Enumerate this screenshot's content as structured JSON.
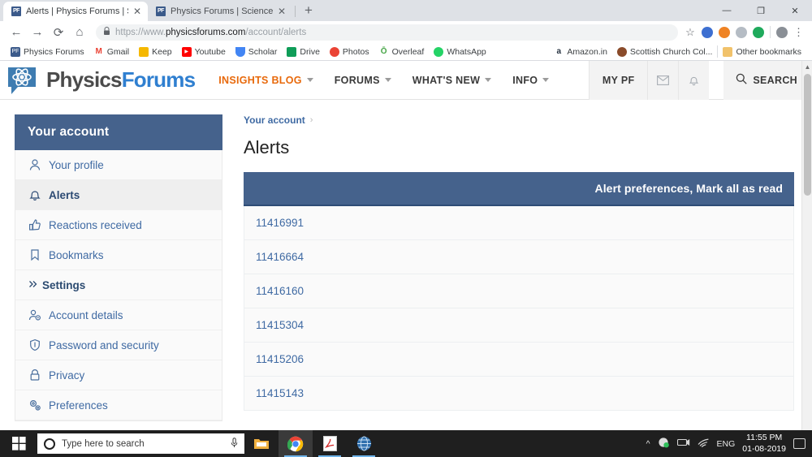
{
  "browser": {
    "tabs": [
      {
        "favicon": "PF",
        "title": "Alerts | Physics Forums | Science ",
        "close": "✕",
        "active": true
      },
      {
        "favicon": "PF",
        "title": "Physics Forums | Science Articles",
        "close": "✕",
        "active": false
      }
    ],
    "new_tab_label": "+",
    "window_controls": {
      "minimize": "—",
      "maximize": "❐",
      "close": "✕"
    },
    "nav": {
      "back": "←",
      "forward": "→",
      "reload": "⟳",
      "home": "⌂"
    },
    "omnibox": {
      "lock_icon": "🔒",
      "url_prefix": "https://www.",
      "url_domain": "physicsforums.com",
      "url_path": "/account/alerts",
      "star_icon": "☆"
    },
    "extensions": [
      {
        "name": "shield-blue-icon",
        "color": "#3d6fd1"
      },
      {
        "name": "circle-orange-icon",
        "color": "#ef8324"
      },
      {
        "name": "shield-gray-icon",
        "color": "#b5bcc4"
      },
      {
        "name": "circle-green-icon",
        "color": "#1faa5c"
      }
    ],
    "profile_avatar": "avatar",
    "menu_dots": "⋮",
    "bookmarks": [
      {
        "label": "Physics Forums",
        "icon_text": "PF",
        "color": "#3b5a8a"
      },
      {
        "label": "Gmail",
        "icon_text": "M",
        "color": "#ea4335"
      },
      {
        "label": "Keep",
        "icon_text": "",
        "color": "#f5b800"
      },
      {
        "label": "Youtube",
        "icon_text": "▶",
        "color": "#ff0000"
      },
      {
        "label": "Scholar",
        "icon_text": "",
        "color": "#4285f4"
      },
      {
        "label": "Drive",
        "icon_text": "",
        "color": "#0f9d58"
      },
      {
        "label": "Photos",
        "icon_text": "",
        "color": "#ea4335"
      },
      {
        "label": "Overleaf",
        "icon_text": "Ō",
        "color": "#46a546"
      },
      {
        "label": "WhatsApp",
        "icon_text": "",
        "color": "#25d366"
      },
      {
        "label": "Amazon.in",
        "icon_text": "a",
        "color": "#ff9900"
      },
      {
        "label": "Scottish Church Col...",
        "icon_text": "",
        "color": "#8a4b2a"
      },
      {
        "label": "Other bookmarks",
        "icon_text": "",
        "color": "#f1c26b"
      }
    ]
  },
  "site": {
    "logo": {
      "text_part1": "Physics",
      "text_part2": "Forums"
    },
    "nav_items": [
      {
        "label": "INSIGHTS BLOG",
        "has_caret": true,
        "accent": true
      },
      {
        "label": "FORUMS",
        "has_caret": true,
        "accent": false
      },
      {
        "label": "WHAT'S NEW",
        "has_caret": true,
        "accent": false
      },
      {
        "label": "INFO",
        "has_caret": true,
        "accent": false
      }
    ],
    "my_pf_label": "MY PF",
    "inbox_icon": "✉",
    "bell_icon": "🔔",
    "search_label": "SEARCH",
    "search_icon": "search-icon"
  },
  "sidebar": {
    "title": "Your account",
    "items": [
      {
        "label": "Your profile",
        "icon": "user-icon",
        "active": false,
        "heading": false
      },
      {
        "label": "Alerts",
        "icon": "bell-icon",
        "active": true,
        "heading": false
      },
      {
        "label": "Reactions received",
        "icon": "thumbs-up-icon",
        "active": false,
        "heading": false
      },
      {
        "label": "Bookmarks",
        "icon": "bookmark-icon",
        "active": false,
        "heading": false
      },
      {
        "label": "Settings",
        "icon": "chevrons-right-icon",
        "active": false,
        "heading": true
      },
      {
        "label": "Account details",
        "icon": "user-gear-icon",
        "active": false,
        "heading": false
      },
      {
        "label": "Password and security",
        "icon": "shield-icon",
        "active": false,
        "heading": false
      },
      {
        "label": "Privacy",
        "icon": "lock-icon",
        "active": false,
        "heading": false
      },
      {
        "label": "Preferences",
        "icon": "gears-icon",
        "active": false,
        "heading": false
      }
    ]
  },
  "main": {
    "breadcrumb": {
      "label": "Your account",
      "separator": "›"
    },
    "page_title": "Alerts",
    "panel_actions": "Alert preferences, Mark all as read",
    "alerts": [
      {
        "id": "11416991"
      },
      {
        "id": "11416664"
      },
      {
        "id": "11416160"
      },
      {
        "id": "11415304"
      },
      {
        "id": "11415206"
      },
      {
        "id": "11415143"
      }
    ]
  },
  "taskbar": {
    "start_icon": "windows-icon",
    "search_placeholder": "Type here to search",
    "mic_icon": "microphone-icon",
    "apps": [
      {
        "name": "file-explorer-icon",
        "running": false,
        "active": false
      },
      {
        "name": "chrome-icon",
        "running": true,
        "active": true
      },
      {
        "name": "adobe-reader-icon",
        "running": true,
        "active": false
      },
      {
        "name": "globe-app-icon",
        "running": true,
        "active": false
      }
    ],
    "tray": {
      "chevron": "^",
      "language": "ENG",
      "time": "11:55 PM",
      "date": "01-08-2019"
    }
  },
  "colors": {
    "pf_blue": "#45628c",
    "link_blue": "#3f6aa3",
    "accent_orange": "#e8690b",
    "logo_blue": "#2f7fd0"
  }
}
